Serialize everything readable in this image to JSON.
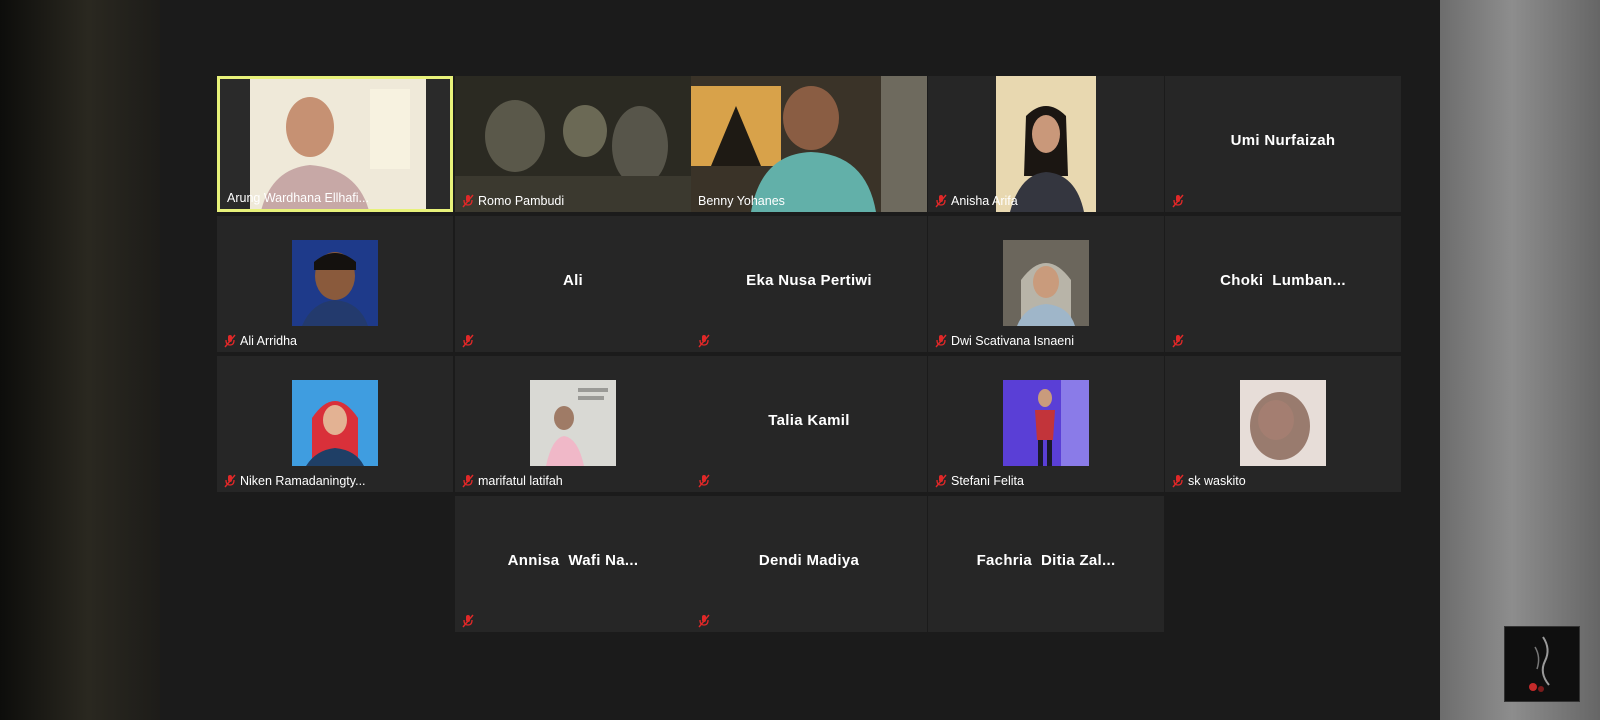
{
  "participants": [
    {
      "name": "Arung Wardhana Ellhafi...",
      "muted": false,
      "active": true,
      "video": "speaker"
    },
    {
      "name": "Romo Pambudi",
      "muted": true,
      "video": "night"
    },
    {
      "name": "Benny Yohanes",
      "muted": false,
      "video": "headset"
    },
    {
      "name": "Anisha Arifa",
      "muted": true,
      "video": "portrait"
    },
    {
      "name": "Umi Nurfaizah",
      "muted": true,
      "video": "none"
    },
    {
      "name": "Ali Arridha",
      "muted": true,
      "video": "avatar-blue"
    },
    {
      "name": "Ali",
      "muted": true,
      "video": "none"
    },
    {
      "name": "Eka Nusa Pertiwi",
      "muted": true,
      "video": "none"
    },
    {
      "name": "Dwi Scativana Isnaeni",
      "muted": true,
      "video": "avatar-hijab"
    },
    {
      "name": "Choki  Lumban...",
      "muted": true,
      "video": "none"
    },
    {
      "name": "Niken Ramadaningty...",
      "muted": true,
      "video": "avatar-red-hijab"
    },
    {
      "name": "marifatul latifah",
      "muted": true,
      "video": "avatar-light"
    },
    {
      "name": "Talia Kamil",
      "muted": true,
      "video": "none"
    },
    {
      "name": "Stefani Felita",
      "muted": true,
      "video": "avatar-purple"
    },
    {
      "name": "sk waskito",
      "muted": true,
      "video": "avatar-blur"
    },
    {
      "name": "Annisa  Wafi Na...",
      "muted": true,
      "video": "none"
    },
    {
      "name": "Dendi Madiya",
      "muted": true,
      "video": "none"
    },
    {
      "name": "Fachria  Ditia Zal...",
      "muted": true,
      "video": "none"
    }
  ],
  "colors": {
    "active_speaker_border": "#e8f27a",
    "muted_icon": "#e02828",
    "tile_background": "#262626"
  },
  "icons": {
    "muted": "microphone-muted-icon"
  }
}
